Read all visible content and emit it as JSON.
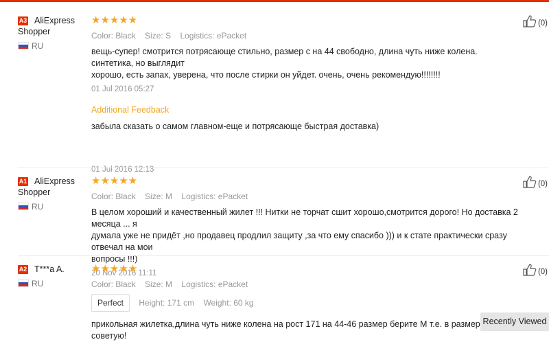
{
  "reviews": [
    {
      "badge": "A3",
      "buyer_line1": "AliExpress",
      "buyer_line2": "Shopper",
      "country": "RU",
      "stars": "★★★★★",
      "color_label": "Color:",
      "color_value": "Black",
      "size_label": "Size:",
      "size_value": "S",
      "logistics_label": "Logistics:",
      "logistics_value": "ePacket",
      "text_line1": "вещь-супер! смотрится потрясающе стильно, размер с на 44 свободно, длина чуть ниже колена. синтетика, но выглядит",
      "text_line2": "хорошо, есть запах, уверена, что после стирки он уйдет. очень, очень рекомендую!!!!!!!!",
      "date": "01 Jul 2016 05:27",
      "additional_title": "Additional Feedback",
      "additional_text": "забыла сказать о самом главном-еще и потрясающе быстрая доставка)",
      "additional_date": "01 Jul 2016 12:13",
      "helpful": "(0)"
    },
    {
      "badge": "A1",
      "buyer_line1": "AliExpress",
      "buyer_line2": "Shopper",
      "country": "RU",
      "stars": "★★★★★",
      "color_label": "Color:",
      "color_value": "Black",
      "size_label": "Size:",
      "size_value": "M",
      "logistics_label": "Logistics:",
      "logistics_value": "ePacket",
      "text_line1": "В целом хороший и качественный жилет !!! Нитки не торчат сшит хорошо,смотрится дорого! Но доставка 2 месяца ... я",
      "text_line2": "думала уже не придёт ,но продавец продлил защиту ,за что ему спасибо ))) и к стате практически сразу отвечал на мои",
      "text_line3": "вопросы !!!)",
      "date": "20 Nov 2016 11:11",
      "helpful": "(0)"
    },
    {
      "badge": "A2",
      "buyer_line1": "T***a A.",
      "country": "RU",
      "stars": "★★★★★",
      "color_label": "Color:",
      "color_value": "Black",
      "size_label": "Size:",
      "size_value": "M",
      "logistics_label": "Logistics:",
      "logistics_value": "ePacket",
      "fit_tag": "Perfect",
      "height_label": "Height:",
      "height_value": "171 cm",
      "weight_label": "Weight:",
      "weight_value": "60 kg",
      "text_line1": "прикольная жилетка,длина чуть ниже колена на рост 171 на 44-46 размер берите M т.е. в размер,смотрит",
      "text_line2": "советую!",
      "helpful": "(0)"
    }
  ],
  "recently_viewed": "Recently Viewed",
  "colors": {
    "brand": "#e62e04",
    "star": "#f5a623"
  }
}
